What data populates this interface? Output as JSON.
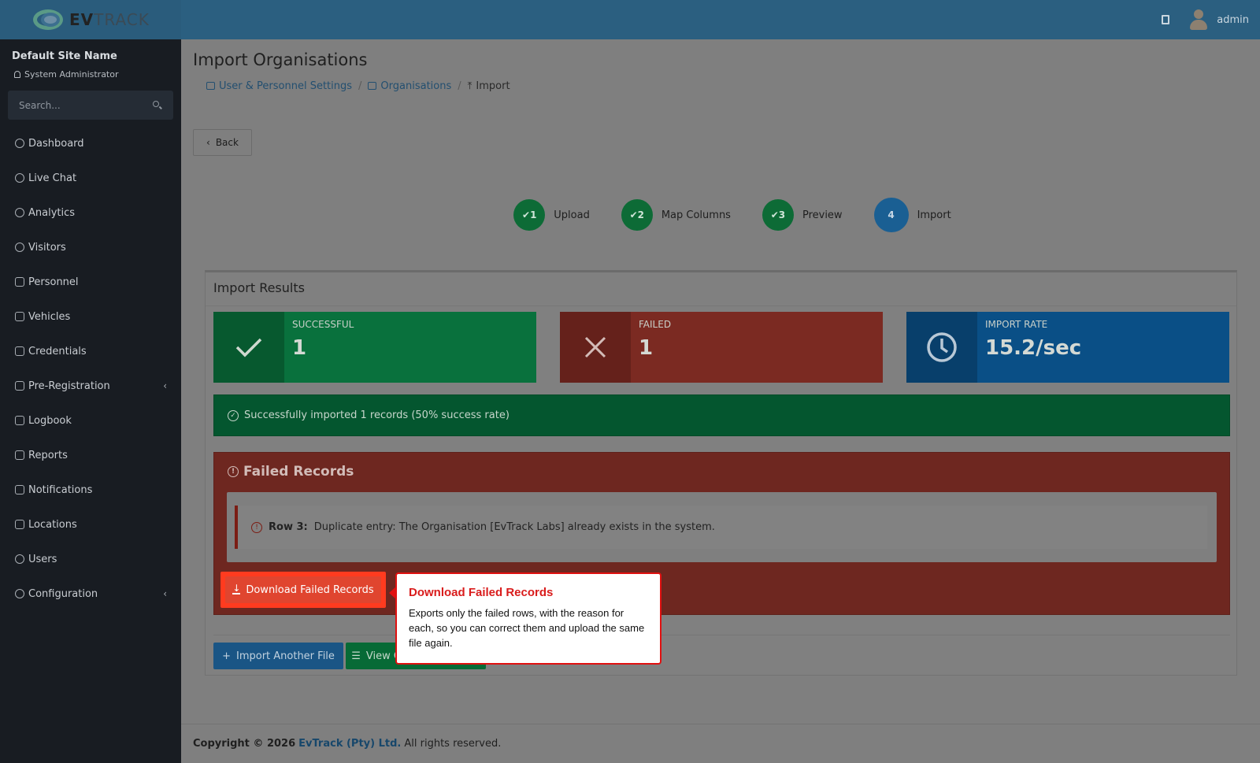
{
  "brand": {
    "logo_text_bold": "EV",
    "logo_text_rest": "TRACK"
  },
  "header": {
    "username": "admin"
  },
  "sidebar": {
    "site_name": "Default Site Name",
    "role": "System Administrator",
    "search_placeholder": "Search...",
    "items": [
      {
        "label": "Dashboard",
        "icon": "dashboard-icon"
      },
      {
        "label": "Live Chat",
        "icon": "headset-icon"
      },
      {
        "label": "Analytics",
        "icon": "target-icon"
      },
      {
        "label": "Visitors",
        "icon": "eye-icon"
      },
      {
        "label": "Personnel",
        "icon": "user-cog-icon"
      },
      {
        "label": "Vehicles",
        "icon": "car-icon"
      },
      {
        "label": "Credentials",
        "icon": "id-card-icon"
      },
      {
        "label": "Pre-Registration",
        "icon": "arrows-icon",
        "expandable": true
      },
      {
        "label": "Logbook",
        "icon": "book-icon"
      },
      {
        "label": "Reports",
        "icon": "chart-icon"
      },
      {
        "label": "Notifications",
        "icon": "chat-icon"
      },
      {
        "label": "Locations",
        "icon": "map-icon"
      },
      {
        "label": "Users",
        "icon": "users-icon"
      },
      {
        "label": "Configuration",
        "icon": "gear-icon",
        "expandable": true
      }
    ]
  },
  "page": {
    "title": "Import Organisations",
    "breadcrumb": [
      "User & Personnel Settings",
      "Organisations",
      "Import"
    ],
    "back_label": "Back"
  },
  "steps": [
    {
      "number": "1",
      "label": "Upload",
      "done": true
    },
    {
      "number": "2",
      "label": "Map Columns",
      "done": true
    },
    {
      "number": "3",
      "label": "Preview",
      "done": true
    },
    {
      "number": "4",
      "label": "Import",
      "done": false
    }
  ],
  "results": {
    "title": "Import Results",
    "successful_label": "SUCCESSFUL",
    "successful_value": "1",
    "failed_label": "FAILED",
    "failed_value": "1",
    "rate_label": "IMPORT RATE",
    "rate_value": "15.2/sec",
    "success_message": "Successfully imported 1 records (50% success rate)",
    "failed_title": "Failed Records",
    "failed_rows": [
      {
        "row": "Row 3:",
        "message": "Duplicate entry: The Organisation [EvTrack Labs] already exists in the system."
      }
    ],
    "download_label": "Download Failed Records",
    "import_another_label": "Import Another File",
    "view_list_label": "View Organisation List"
  },
  "tooltip": {
    "title": "Download Failed Records",
    "body": "Exports only the failed rows, with the reason for each, so you can correct them and upload the same file again."
  },
  "footer": {
    "prefix": "Copyright © 2026",
    "company": "EvTrack (Pty) Ltd.",
    "suffix": "All rights reserved."
  },
  "colors": {
    "success": "#09713d",
    "danger": "#7b2a22",
    "info": "#0a4f86",
    "tooltip_border": "#e01010"
  }
}
